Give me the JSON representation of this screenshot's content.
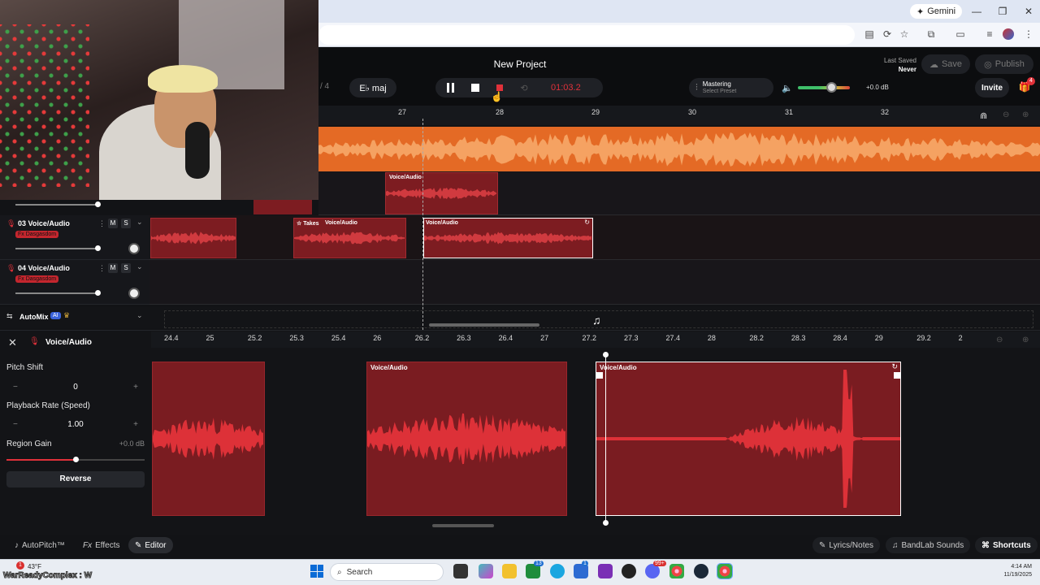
{
  "browser": {
    "gemini_label": "Gemini",
    "minimize": "—",
    "restore": "❐",
    "close": "✕"
  },
  "project": {
    "title": "New Project",
    "last_saved_label": "Last Saved",
    "last_saved_value": "Never",
    "save_label": "Save",
    "publish_label": "Publish",
    "invite_label": "Invite",
    "gift_badge": "4"
  },
  "transport": {
    "meter_fragment": "/ 4",
    "key": "E♭ maj",
    "time": "01:03.2",
    "mastering_label": "Mastering",
    "mastering_preset": "Select Preset",
    "volume_db": "+0.0 dB"
  },
  "timeline": {
    "ticks": [
      "27",
      "28",
      "29",
      "30",
      "31",
      "32"
    ]
  },
  "tracks": [
    {
      "name": "03 Voice/Audio",
      "fx": "Fx Dasgasdom",
      "mute": "M",
      "solo": "S"
    },
    {
      "name": "04 Voice/Audio",
      "fx": "Fx Dasgasdom",
      "mute": "M",
      "solo": "S"
    }
  ],
  "regions": {
    "voice_label": "Voice/Audio",
    "takes_label": "Takes"
  },
  "automix": {
    "label": "AutoMix",
    "badge": "AI"
  },
  "editor": {
    "title": "Voice/Audio",
    "pitch_shift_label": "Pitch Shift",
    "pitch_shift_value": "0",
    "playback_rate_label": "Playback Rate (Speed)",
    "playback_rate_value": "1.00",
    "region_gain_label": "Region Gain",
    "region_gain_value": "+0.0 dB",
    "reverse_label": "Reverse",
    "ruler_ticks": [
      "24.4",
      "25",
      "25.2",
      "25.3",
      "25.4",
      "26",
      "26.2",
      "26.3",
      "26.4",
      "27",
      "27.2",
      "27.3",
      "27.4",
      "28",
      "28.2",
      "28.3",
      "28.4",
      "29",
      "29.2",
      "2"
    ]
  },
  "bottom_bar": {
    "autopitch": "AutoPitch™",
    "effects": "Effects",
    "editor": "Editor",
    "lyrics": "Lyrics/Notes",
    "sounds": "BandLab Sounds",
    "shortcuts": "Shortcuts"
  },
  "taskbar": {
    "weather": "43°F",
    "search_placeholder": "Search",
    "time": "4:14 AM",
    "date": "11/19/2025",
    "watermark": "WarReadyComplex : W",
    "badges": [
      "13",
      "1",
      "99+"
    ]
  },
  "colors": {
    "orange_track": "#f07a30",
    "red_region": "#7d1c21",
    "record": "#e0313a",
    "accent_green": "#3fbf6a"
  }
}
